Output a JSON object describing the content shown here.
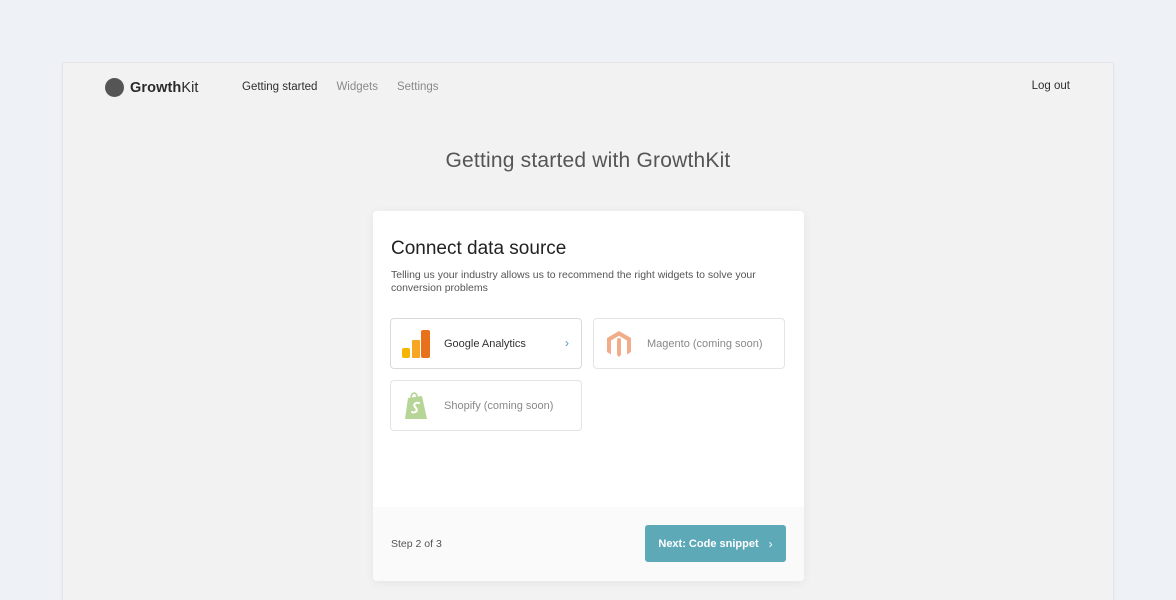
{
  "app": {
    "logo_bold": "Growth",
    "logo_light": "Kit"
  },
  "nav": {
    "items": [
      {
        "label": "Getting started",
        "active": true
      },
      {
        "label": "Widgets",
        "active": false
      },
      {
        "label": "Settings",
        "active": false
      }
    ],
    "logout_label": "Log out"
  },
  "page": {
    "title": "Getting started with GrowthKit"
  },
  "card": {
    "title": "Connect data source",
    "description": "Telling us your industry allows us to recommend the right widgets to solve your conversion problems",
    "sources": [
      {
        "label": "Google Analytics",
        "icon": "google-analytics-icon",
        "enabled": true
      },
      {
        "label": "Magento (coming soon)",
        "icon": "magento-icon",
        "enabled": false
      },
      {
        "label": "Shopify (coming soon)",
        "icon": "shopify-icon",
        "enabled": false
      }
    ],
    "step_text": "Step 2 of 3",
    "next_label": "Next: Code snippet",
    "next_chevron": "›",
    "source_chevron": "›"
  },
  "colors": {
    "accent": "#5ea9b8",
    "background": "#eef1f5",
    "window": "#f2f2f2"
  }
}
